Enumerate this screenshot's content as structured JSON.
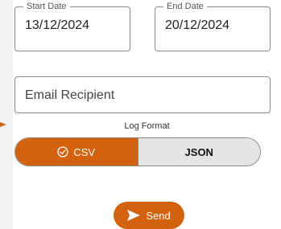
{
  "form": {
    "start_date": {
      "label": "Start Date",
      "value": "13/12/2024"
    },
    "end_date": {
      "label": "End Date",
      "value": "20/12/2024"
    },
    "email": {
      "placeholder": "Email Recipient",
      "value": ""
    },
    "log_format": {
      "label": "Log Format",
      "options": [
        "CSV",
        "JSON"
      ],
      "selected": "CSV"
    },
    "send_button": {
      "label": "Send",
      "icon": "send-icon"
    }
  },
  "colors": {
    "accent": "#d3620e",
    "unselected_segment": "#e4e4e4",
    "border": "#8a8a8a",
    "background": "#f2f2f5"
  }
}
